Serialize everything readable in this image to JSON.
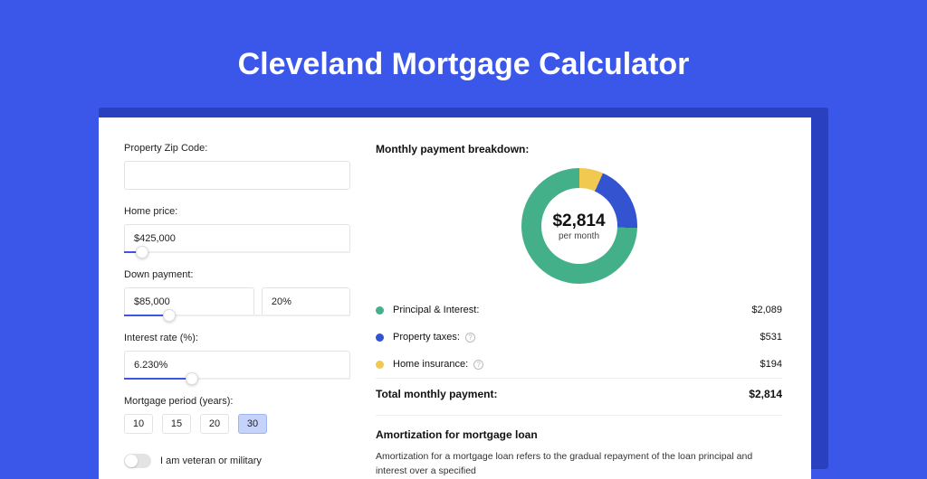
{
  "hero": {
    "title": "Cleveland Mortgage Calculator"
  },
  "form": {
    "zip_label": "Property Zip Code:",
    "zip_value": "",
    "home_price_label": "Home price:",
    "home_price_value": "$425,000",
    "home_price_pct": 8,
    "down_label": "Down payment:",
    "down_value": "$85,000",
    "down_pct_value": "20%",
    "down_slider_pct": 20,
    "rate_label": "Interest rate (%):",
    "rate_value": "6.230%",
    "rate_slider_pct": 30,
    "period_label": "Mortgage period (years):",
    "periods": [
      "10",
      "15",
      "20",
      "30"
    ],
    "period_active": "30",
    "veteran_label": "I am veteran or military"
  },
  "breakdown": {
    "title": "Monthly payment breakdown:",
    "donut": {
      "amount": "$2,814",
      "sub": "per month",
      "css": "background: conic-gradient(#f1c850 0deg 24deg, #3453d1 24deg 92deg, #44b08a 92deg 360deg);"
    },
    "rows": [
      {
        "label": "Principal & Interest:",
        "value": "$2,089",
        "color": "#44b08a",
        "info": false
      },
      {
        "label": "Property taxes:",
        "value": "$531",
        "color": "#3453d1",
        "info": true
      },
      {
        "label": "Home insurance:",
        "value": "$194",
        "color": "#f1c850",
        "info": true
      }
    ],
    "total_label": "Total monthly payment:",
    "total_value": "$2,814"
  },
  "amort": {
    "title": "Amortization for mortgage loan",
    "body": "Amortization for a mortgage loan refers to the gradual repayment of the loan principal and interest over a specified"
  },
  "chart_data": {
    "type": "pie",
    "title": "Monthly payment breakdown",
    "series": [
      {
        "name": "Principal & Interest",
        "value": 2089,
        "color": "#44b08a"
      },
      {
        "name": "Property taxes",
        "value": 531,
        "color": "#3453d1"
      },
      {
        "name": "Home insurance",
        "value": 194,
        "color": "#f1c850"
      }
    ],
    "total": 2814,
    "unit": "USD per month"
  }
}
